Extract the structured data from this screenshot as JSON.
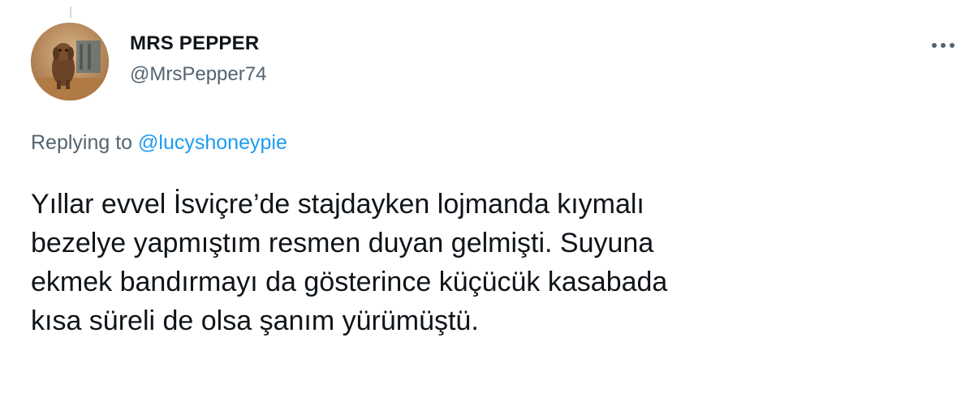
{
  "tweet": {
    "display_name": "MRS PEPPER",
    "handle": "@MrsPepper74",
    "avatar_icon": "profile-photo-dog",
    "more_icon": "more-options-icon",
    "replying_prefix": "Replying to",
    "replying_to": "@lucyshoneypie",
    "text_lines": [
      "Yıllar evvel İsviçre’de stajdayken lojmanda kıymalı",
      "bezelye yapmıştım resmen duyan gelmişti. Suyuna",
      "ekmek bandırmayı da gösterince küçücük kasabada",
      "kısa süreli de olsa şanım yürümüştü."
    ]
  },
  "colors": {
    "primary_text": "#0f1419",
    "secondary_text": "#536471",
    "link": "#1d9bf0"
  }
}
